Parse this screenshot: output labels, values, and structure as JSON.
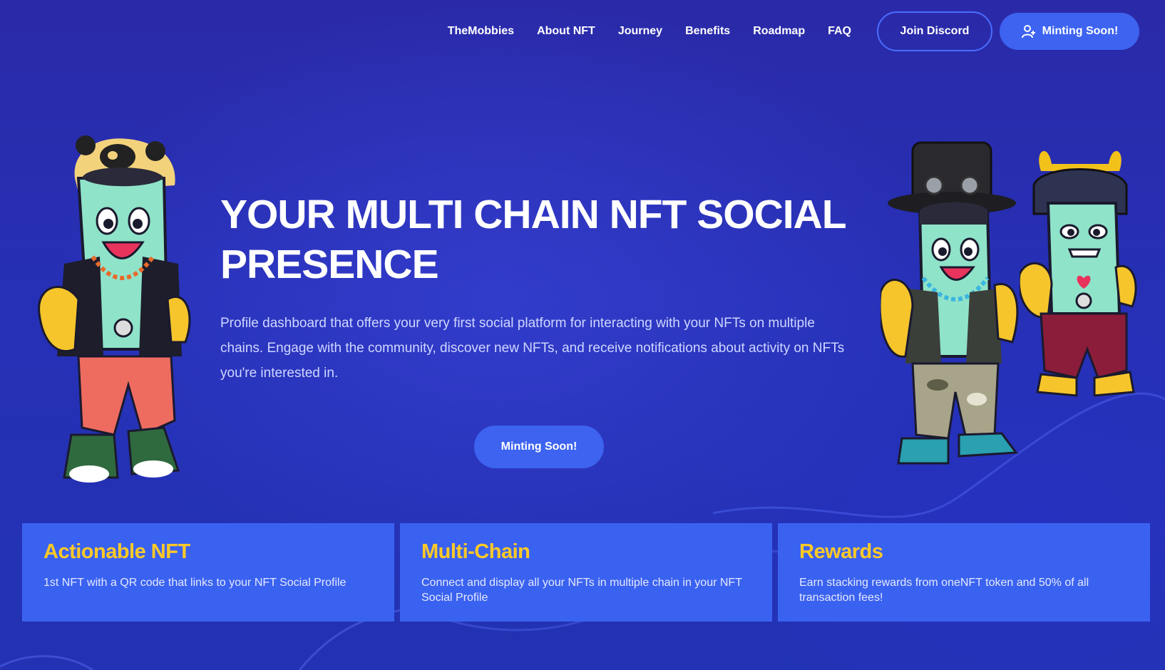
{
  "nav": {
    "links": [
      "TheMobbies",
      "About NFT",
      "Journey",
      "Benefits",
      "Roadmap",
      "FAQ"
    ],
    "join_discord": "Join Discord",
    "minting": "Minting Soon!",
    "minting_icon": "user-plus-icon"
  },
  "hero": {
    "title": "YOUR MULTI CHAIN NFT SOCIAL PRESENCE",
    "description": "Profile dashboard that offers your very first social platform for interacting with your NFTs on multiple chains. Engage with the community, discover new NFTs, and receive notifications about activity on NFTs you're interested in.",
    "cta": "Minting Soon!"
  },
  "features": [
    {
      "title": "Actionable NFT",
      "text": "1st NFT with a QR code that links to your NFT Social Profile"
    },
    {
      "title": "Multi-Chain",
      "text": "Connect and display all your NFTs in multiple chain in your NFT Social Profile"
    },
    {
      "title": "Rewards",
      "text": "Earn stacking rewards from oneNFT token and 50% of all transaction fees!"
    }
  ],
  "colors": {
    "background": "#2a2db0",
    "accent_blue": "#3d63f0",
    "card_title": "#ffc927"
  }
}
